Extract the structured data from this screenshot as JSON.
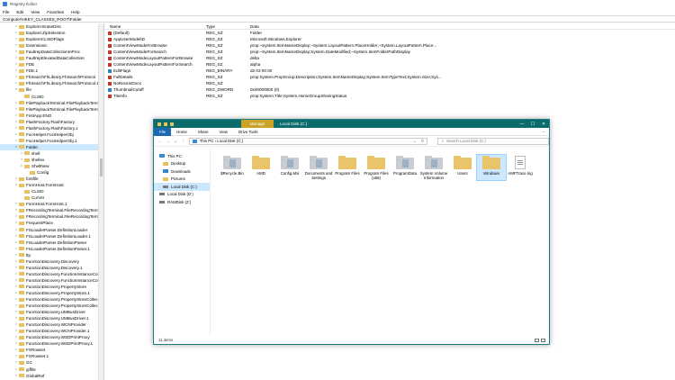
{
  "regedit": {
    "title": "Registry Editor",
    "menu": [
      "File",
      "Edit",
      "View",
      "Favorites",
      "Help"
    ],
    "address": "Computer\\HKEY_CLASSES_ROOT\\Folder",
    "tree": [
      {
        "label": "Explorer.EraseDisc",
        "exp": ">"
      },
      {
        "label": "Explorer.ZipSelection",
        "exp": ">"
      },
      {
        "label": "ExplorerCLSIDFlags",
        "exp": ">"
      },
      {
        "label": "Extensionic",
        "exp": ">"
      },
      {
        "label": "FaultrepDataCollectionInProc",
        "exp": ">"
      },
      {
        "label": "FaultrepElevatedDataCollection",
        "exp": ">"
      },
      {
        "label": "FDE",
        "exp": ">"
      },
      {
        "label": "FDE.1",
        "exp": ">"
      },
      {
        "label": "FhSearchFhLibrary.FhSearchProtocol",
        "exp": ">"
      },
      {
        "label": "FhSearchFhLibrary.FhSearchProtocol.1",
        "exp": ">"
      },
      {
        "label": "file",
        "exp": "v"
      },
      {
        "label": "CLSID",
        "exp": "",
        "indent": 1
      },
      {
        "label": "FilePlaybackTerminal.FilePlaybackTermin",
        "exp": ">"
      },
      {
        "label": "FilePlaybackTerminal.FilePlaybackTermin",
        "exp": ">"
      },
      {
        "label": "FirstApp.ENO",
        "exp": ">"
      },
      {
        "label": "FlashFactory.FlashFactory",
        "exp": ">"
      },
      {
        "label": "FlashFactory.FlashFactory.1",
        "exp": ">"
      },
      {
        "label": "FociHelper.FociHelperObj",
        "exp": ">"
      },
      {
        "label": "FociHelper.FociHelperObj.1",
        "exp": ">"
      },
      {
        "label": "Folder",
        "exp": "v",
        "sel": true
      },
      {
        "label": "shell",
        "exp": ">",
        "indent": 1
      },
      {
        "label": "shellex",
        "exp": ">",
        "indent": 1
      },
      {
        "label": "ShellNew",
        "exp": "v",
        "indent": 1
      },
      {
        "label": "Config",
        "exp": "",
        "indent": 2
      },
      {
        "label": "fontfile",
        "exp": ">"
      },
      {
        "label": "FormHost.FormHost",
        "exp": "v"
      },
      {
        "label": "CLSID",
        "exp": "",
        "indent": 1
      },
      {
        "label": "CurVer",
        "exp": "",
        "indent": 1
      },
      {
        "label": "FormHost.FormHost.1",
        "exp": ">"
      },
      {
        "label": "FRecordingTerminal.FileRecordingTermi",
        "exp": ">"
      },
      {
        "label": "FRecordingTerminal.FileRecordingTermi",
        "exp": ">"
      },
      {
        "label": "FrequentPlace",
        "exp": ">"
      },
      {
        "label": "FSLoaderParser.DefinitionLoader",
        "exp": ">"
      },
      {
        "label": "FSLoaderParser.DefinitionLoader.1",
        "exp": ">"
      },
      {
        "label": "FSLoaderParser.DefinitionParser",
        "exp": ">"
      },
      {
        "label": "FSLoaderParser.DefinitionParser.1",
        "exp": ">"
      },
      {
        "label": "ftp",
        "exp": ">"
      },
      {
        "label": "FunctionDiscovery.Discovery",
        "exp": ">"
      },
      {
        "label": "FunctionDiscovery.Discovery.1",
        "exp": ">"
      },
      {
        "label": "FunctionDiscovery.FunctionInstanceCol",
        "exp": ">"
      },
      {
        "label": "FunctionDiscovery.FunctionInstanceCol",
        "exp": ">"
      },
      {
        "label": "FunctionDiscovery.PropertyStore",
        "exp": ">"
      },
      {
        "label": "FunctionDiscovery.PropertyStore.1",
        "exp": ">"
      },
      {
        "label": "FunctionDiscovery.PropertyStoreCollect",
        "exp": ">"
      },
      {
        "label": "FunctionDiscovery.PropertyStoreCollect",
        "exp": ">"
      },
      {
        "label": "FunctionDiscovery.UMBusDriver",
        "exp": ">"
      },
      {
        "label": "FunctionDiscovery.UMBusDriver.1",
        "exp": ">"
      },
      {
        "label": "FunctionDiscovery.WCNProvider",
        "exp": ">"
      },
      {
        "label": "FunctionDiscovery.WCNProvider.1",
        "exp": ">"
      },
      {
        "label": "FunctionDiscovery.WSDPrintProxy",
        "exp": ">"
      },
      {
        "label": "FunctionDiscovery.WSDPrintProxy.1",
        "exp": ">"
      },
      {
        "label": "FXRowset",
        "exp": ">"
      },
      {
        "label": "FXRowset.1",
        "exp": ">"
      },
      {
        "label": "GC",
        "exp": ">"
      },
      {
        "label": "giffile",
        "exp": ">"
      },
      {
        "label": "GlobalRef",
        "exp": ">"
      }
    ],
    "columns": {
      "name": "Name",
      "type": "Type",
      "data": "Data"
    },
    "values": [
      {
        "name": "(Default)",
        "type": "REG_SZ",
        "data": "Folder",
        "icon": "sz"
      },
      {
        "name": "AppUserModelID",
        "type": "REG_SZ",
        "data": "Microsoft.Windows.Explorer",
        "icon": "sz"
      },
      {
        "name": "ContentViewModeForBrowse",
        "type": "REG_SZ",
        "data": "prop:~System.ItemNameDisplay;~System.LayoutPattern.PlaceHolder;~System.LayoutPattern.Place...",
        "icon": "sz"
      },
      {
        "name": "ContentViewModeForSearch",
        "type": "REG_SZ",
        "data": "prop:~System.ItemNameDisplay;System.DateModified;~System.ItemFolderPathDisplay",
        "icon": "sz"
      },
      {
        "name": "ContentViewModeLayoutPatternForBrowse",
        "type": "REG_SZ",
        "data": "delta",
        "icon": "sz"
      },
      {
        "name": "ContentViewModeLayoutPatternForSearch",
        "type": "REG_SZ",
        "data": "alpha",
        "icon": "sz"
      },
      {
        "name": "EditFlags",
        "type": "REG_BINARY",
        "data": "d2 03 00 00",
        "icon": "bin"
      },
      {
        "name": "FullDetails",
        "type": "REG_SZ",
        "data": "prop:System.PropGroup.Description;System.ItemNameDisplay;System.ItemTypeText;System.Size;Sys...",
        "icon": "sz"
      },
      {
        "name": "NoRecentDocs",
        "type": "REG_SZ",
        "data": "",
        "icon": "sz"
      },
      {
        "name": "ThumbnailCutoff",
        "type": "REG_DWORD",
        "data": "0x00000000 (0)",
        "icon": "bin"
      },
      {
        "name": "TileInfo",
        "type": "REG_SZ",
        "data": "prop:System.Title;System.HomeGroupSharingStatus",
        "icon": "sz"
      }
    ]
  },
  "explorer": {
    "manage_tab": "Manage",
    "title": "Local Disk (C:)",
    "controls": {
      "min": "—",
      "max": "☐",
      "close": "✕"
    },
    "ribbon_tabs": [
      "File",
      "Home",
      "Share",
      "View",
      "Drive Tools"
    ],
    "address": {
      "path": "This PC  ›  Local Disk (C:)",
      "dropdown": "⌄",
      "refresh": "↻"
    },
    "search_placeholder": "Search Local Disk (C:)",
    "nav": [
      {
        "label": "This PC",
        "icon": "pc",
        "indent": false
      },
      {
        "label": "Desktop",
        "icon": "f",
        "indent": true
      },
      {
        "label": "Downloads",
        "icon": "dl",
        "indent": true
      },
      {
        "label": "Pictures",
        "icon": "f",
        "indent": true
      },
      {
        "label": "Local Disk (C:)",
        "icon": "drive",
        "indent": true,
        "sel": true
      },
      {
        "label": "Local Disk (D:)",
        "icon": "drive",
        "indent": false
      },
      {
        "label": "RAMDisk (Z:)",
        "icon": "drive",
        "indent": false
      }
    ],
    "items": [
      {
        "label": "$Recycle.Bin",
        "kind": "grey"
      },
      {
        "label": "AMD",
        "kind": "folder"
      },
      {
        "label": "Config.Msi",
        "kind": "grey"
      },
      {
        "label": "Documents and Settings",
        "kind": "grey"
      },
      {
        "label": "Program Files",
        "kind": "folder"
      },
      {
        "label": "Program Files (x86)",
        "kind": "folder"
      },
      {
        "label": "ProgramData",
        "kind": "grey"
      },
      {
        "label": "System Volume Information",
        "kind": "grey"
      },
      {
        "label": "Users",
        "kind": "folder"
      },
      {
        "label": "Windows",
        "kind": "folder",
        "sel": true
      },
      {
        "label": "AMFTrace.log",
        "kind": "doc"
      }
    ],
    "status": "11 items"
  }
}
